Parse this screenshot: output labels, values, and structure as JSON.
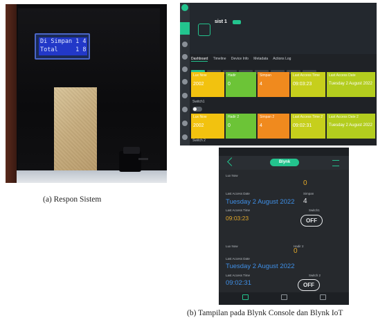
{
  "figure_a": {
    "lcd_line1": "Di Simpan 1 4",
    "lcd_line2": "Total     1 8",
    "caption": "(a) Respon Sistem"
  },
  "figure_b": {
    "caption": "(b) Tampilan pada Blynk Console dan Blynk IoT",
    "console": {
      "device_name": "sist 1",
      "tabs": [
        "Dashboard",
        "Timeline",
        "Device Info",
        "Metadata",
        "Actions Log"
      ],
      "active_tab": "Dashboard",
      "tiles_row1": [
        {
          "title": "Lux Now",
          "value": "2002",
          "color": "#f2c20f"
        },
        {
          "title": "Hadir",
          "value": "0",
          "color": "#6cc437"
        },
        {
          "title": "Simpan",
          "value": "4",
          "color": "#f08a1e"
        },
        {
          "title": "Last Access Time",
          "value": "09:03:23",
          "color": "#c6cf1c"
        },
        {
          "title": "Last Access Date",
          "value": "Tuesday 2 August 2022",
          "color": "#b3cd1e"
        }
      ],
      "switch1_label": "Switch1",
      "tiles_row2": [
        {
          "title": "Lux Now",
          "value": "2002",
          "color": "#f2c20f"
        },
        {
          "title": "Hadir 2",
          "value": "0",
          "color": "#6cc437"
        },
        {
          "title": "Simpan 2",
          "value": "4",
          "color": "#f08a1e"
        },
        {
          "title": "Last Access Time 2",
          "value": "09:02:31",
          "color": "#c6cf1c"
        },
        {
          "title": "Last Access Date 2",
          "value": "Tuesday 2 August 2022",
          "color": "#b3cd1e"
        }
      ],
      "switch2_label": "Switch 2",
      "accent": "#23c48e"
    },
    "phone": {
      "brand": "Blynk",
      "section1": {
        "lux_label": "Lux Now",
        "count_value": "0",
        "date_label": "Last Access Date",
        "date_value": "Tuesday 2 August 2022",
        "stored_label": "Simpan",
        "stored_value": "4",
        "time_label": "Last Access Time",
        "time_value": "09:03:23",
        "switch_label": "Switch1",
        "switch_state": "OFF"
      },
      "section2": {
        "lux_label": "Lux Now",
        "count_label": "Hadir 2",
        "count_value": "0",
        "date_label": "Last Access Date",
        "date_value": "Tuesday 2 August 2022",
        "time_label": "Last Access Time",
        "time_value": "09:02:31",
        "switch_label": "Switch 2",
        "switch_state": "OFF"
      }
    }
  }
}
